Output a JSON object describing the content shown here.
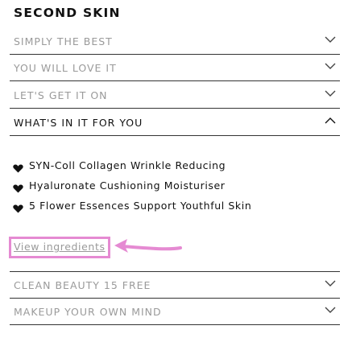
{
  "section_title": "SECOND SKIN",
  "accordion_top": [
    {
      "label": "SIMPLY THE BEST",
      "state": "collapsed"
    },
    {
      "label": "YOU WILL LOVE IT",
      "state": "collapsed"
    },
    {
      "label": "LET'S GET IT ON",
      "state": "collapsed"
    },
    {
      "label": "WHAT'S IN IT FOR YOU",
      "state": "expanded"
    }
  ],
  "features": [
    {
      "icon": "heart-icon",
      "text": "SYN-Coll Collagen Wrinkle Reducing"
    },
    {
      "icon": "heart-icon",
      "text": "Hyaluronate Cushioning Moisturiser"
    },
    {
      "icon": "heart-icon",
      "text": "5 Flower Essences Support Youthful Skin"
    }
  ],
  "view_ingredients_link": "View ingredients",
  "accordion_bottom": [
    {
      "label": "CLEAN BEAUTY 15 FREE",
      "state": "collapsed"
    },
    {
      "label": "MAKEUP YOUR OWN MIND",
      "state": "collapsed"
    }
  ],
  "colors": {
    "text": "#111111",
    "muted": "#9a9a9a",
    "divider": "#333333",
    "annotation": "#e58ad2"
  }
}
